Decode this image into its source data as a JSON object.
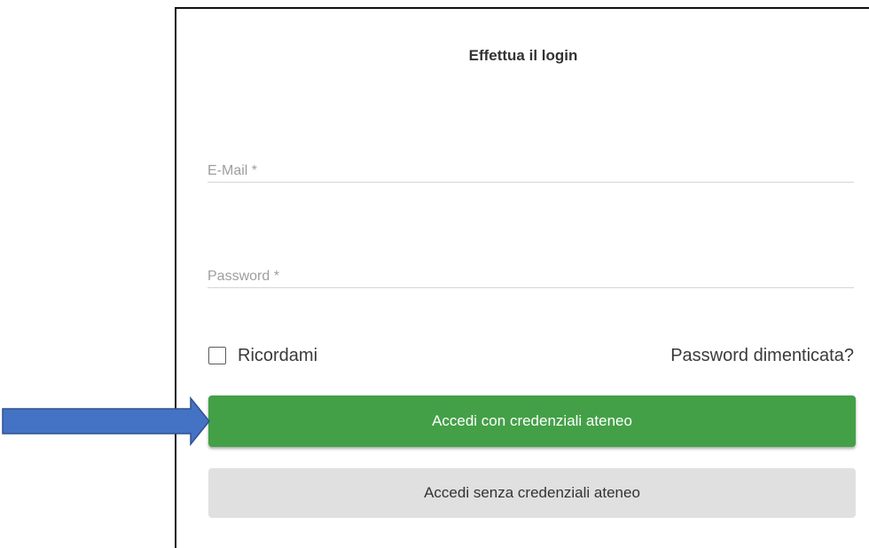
{
  "login": {
    "title": "Effettua il login",
    "email_placeholder": "E-Mail *",
    "email_value": "",
    "password_placeholder": "Password *",
    "password_value": "",
    "remember_label": "Ricordami",
    "remember_checked": false,
    "forgot_link": "Password dimenticata?",
    "primary_button": "Accedi con credenziali ateneo",
    "secondary_button": "Accedi senza credenziali ateneo"
  },
  "colors": {
    "primary_button": "#43a047",
    "secondary_button": "#e0e0e0",
    "annotation_arrow_fill": "#4472c4",
    "annotation_arrow_stroke": "#2f528f"
  },
  "annotation": {
    "icon": "arrow-right-icon"
  }
}
